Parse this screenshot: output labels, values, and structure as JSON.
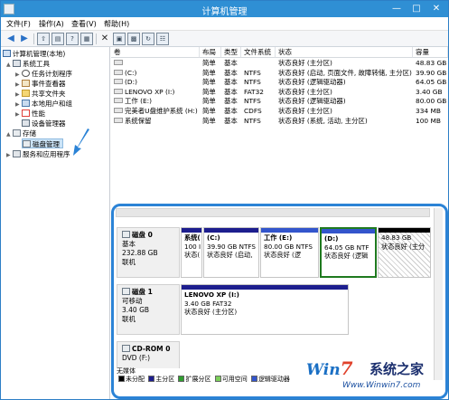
{
  "window": {
    "title": "计算机管理",
    "minimize": "—",
    "maximize": "□",
    "close": "✕"
  },
  "menu": [
    "文件(F)",
    "操作(A)",
    "查看(V)",
    "帮助(H)"
  ],
  "toolbar": {
    "back_icon": "arrow-left",
    "forward_icon": "arrow-right",
    "delete_glyph": "✕"
  },
  "tree": {
    "root": "计算机管理(本地)",
    "system_tools": "系统工具",
    "task_scheduler": "任务计划程序",
    "event_viewer": "事件查看器",
    "shared_folders": "共享文件夹",
    "local_users": "本地用户和组",
    "performance": "性能",
    "device_manager": "设备管理器",
    "storage": "存储",
    "disk_management": "磁盘管理",
    "services_apps": "服务和应用程序",
    "expand_open": "▲",
    "expand_closed": "▶"
  },
  "volume_table": {
    "headers": [
      "卷",
      "布局",
      "类型",
      "文件系统",
      "状态",
      "容量"
    ],
    "rows": [
      {
        "name": "",
        "layout": "简单",
        "type": "基本",
        "fs": "",
        "status": "状态良好 (主分区)",
        "capacity": "48.83 GB"
      },
      {
        "name": "(C:)",
        "layout": "简单",
        "type": "基本",
        "fs": "NTFS",
        "status": "状态良好 (启动, 页面文件, 故障转储, 主分区)",
        "capacity": "39.90 GB"
      },
      {
        "name": "(D:)",
        "layout": "简单",
        "type": "基本",
        "fs": "NTFS",
        "status": "状态良好 (逻辑驱动器)",
        "capacity": "64.05 GB"
      },
      {
        "name": "LENOVO XP (I:)",
        "layout": "简单",
        "type": "基本",
        "fs": "FAT32",
        "status": "状态良好 (主分区)",
        "capacity": "3.40 GB"
      },
      {
        "name": "工作 (E:)",
        "layout": "简单",
        "type": "基本",
        "fs": "NTFS",
        "status": "状态良好 (逻辑驱动器)",
        "capacity": "80.00 GB"
      },
      {
        "name": "完美者U盘维护系统 (H:)",
        "layout": "简单",
        "type": "基本",
        "fs": "CDFS",
        "status": "状态良好 (主分区)",
        "capacity": "334 MB"
      },
      {
        "name": "系统保留",
        "layout": "简单",
        "type": "基本",
        "fs": "NTFS",
        "status": "状态良好 (系统, 活动, 主分区)",
        "capacity": "100 MB"
      }
    ]
  },
  "disks": {
    "disk0": {
      "name": "磁盘 0",
      "type": "基本",
      "size": "232.88 GB",
      "status": "联机",
      "partitions": [
        {
          "label": "系统(",
          "line2": "100 I",
          "line3": "状态("
        },
        {
          "label": "(C:)",
          "line2": "39.90 GB NTFS",
          "line3": "状态良好 (启动,"
        },
        {
          "label": "工作 (E:)",
          "line2": "80.00 GB NTFS",
          "line3": "状态良好 (逻"
        },
        {
          "label": "(D:)",
          "line2": "64.05 GB NTF",
          "line3": "状态良好 (逻辑"
        },
        {
          "label": "",
          "line2": "48.83 GB",
          "line3": "状态良好 (主分"
        }
      ]
    },
    "disk1": {
      "name": "磁盘 1",
      "type": "可移动",
      "size": "3.40 GB",
      "status": "联机",
      "partition": {
        "label": "LENOVO XP (I:)",
        "line2": "3.40 GB FAT32",
        "line3": "状态良好 (主分区)"
      }
    },
    "cdrom0": {
      "name": "CD-ROM 0",
      "type": "DVD (F:)",
      "status": "无媒体"
    }
  },
  "legend": {
    "items": [
      {
        "label": "未分配",
        "color": "#000000"
      },
      {
        "label": "主分区",
        "color": "#1d1e8e"
      },
      {
        "label": "扩展分区",
        "color": "#2f9e2f"
      },
      {
        "label": "可用空间",
        "color": "#7ccf5a"
      },
      {
        "label": "逻辑驱动器",
        "color": "#3355cc"
      }
    ]
  },
  "watermark": {
    "logo_prefix": "Win",
    "logo_seven": "7",
    "logo_cn": "系统之家",
    "url": "Www.Winwin7.com"
  },
  "colors": {
    "titlebar": "#2f8fd4",
    "highlight_border": "#2b83d6",
    "selected_partition": "#1f7a1f"
  }
}
